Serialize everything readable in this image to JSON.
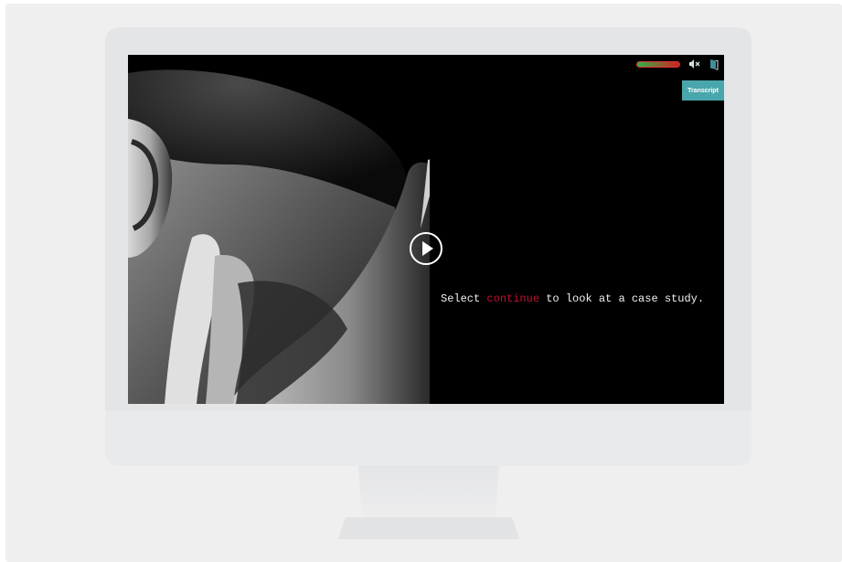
{
  "player": {
    "caption_prefix": "Select",
    "caption_link": "continue",
    "caption_suffix": " to look at a case study.",
    "transcript_label": "Transcript",
    "progress": 1.0
  },
  "icons": {
    "mute": "speaker-muted-icon",
    "exit": "exit-door-icon",
    "play": "play-circle-icon"
  },
  "colors": {
    "accent_red": "#c8102e",
    "transcript_teal": "#4aa6ad",
    "screen_bg": "#000000"
  }
}
